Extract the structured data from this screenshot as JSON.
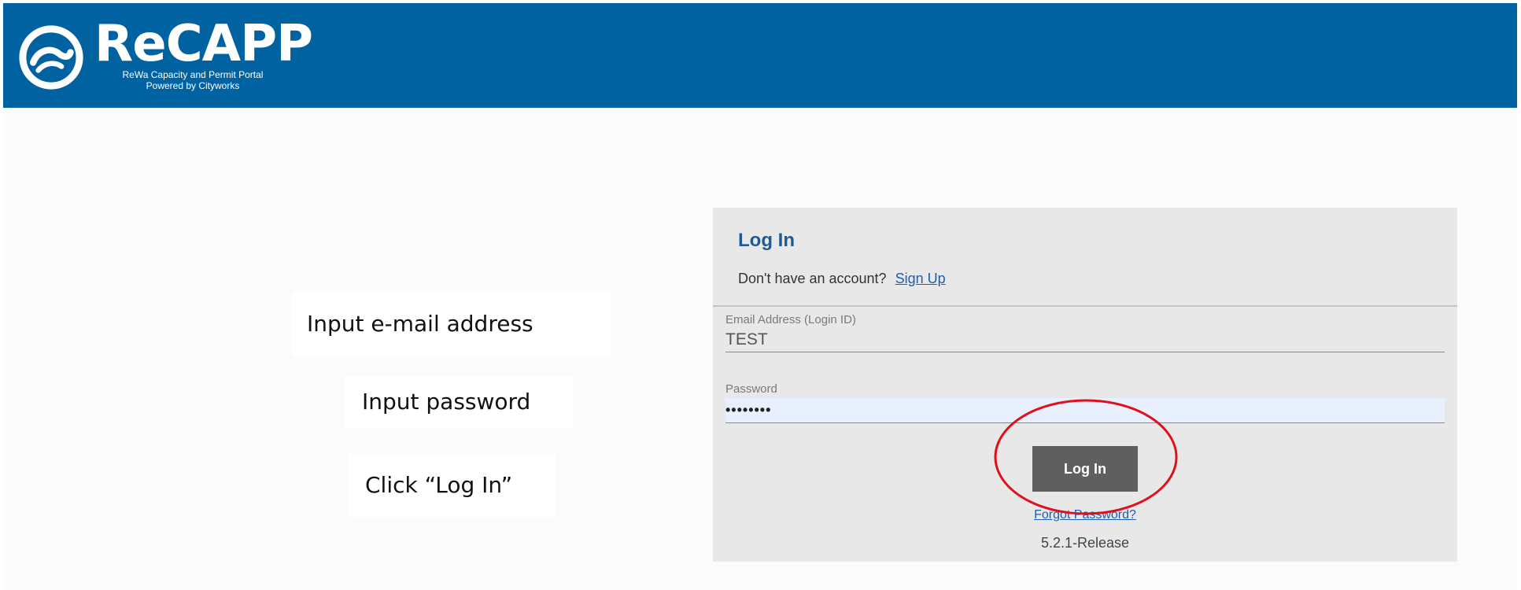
{
  "header": {
    "app_name": "ReCAPP",
    "subtitle_line1": "ReWa Capacity and Permit Portal",
    "subtitle_line2": "Powered by Cityworks",
    "logo_icon": "wave-swirl-icon",
    "background_color": "#0062a1"
  },
  "instructions": {
    "email": "Input e-mail address",
    "password": "Input password",
    "click": "Click “Log In”"
  },
  "login": {
    "title": "Log In",
    "no_account_text": "Don't have an account?",
    "signup_label": "Sign Up",
    "email_label": "Email Address (Login ID)",
    "email_value": "TEST",
    "password_label": "Password",
    "password_value": "••••••••",
    "login_button": "Log In",
    "forgot_password": "Forgot Password?",
    "version": "5.2.1-Release"
  },
  "colors": {
    "accent_blue": "#1f5b92",
    "link_blue": "#1a5fb4",
    "button_gray": "#5f5f5f",
    "annotation_red": "#e0101a"
  }
}
